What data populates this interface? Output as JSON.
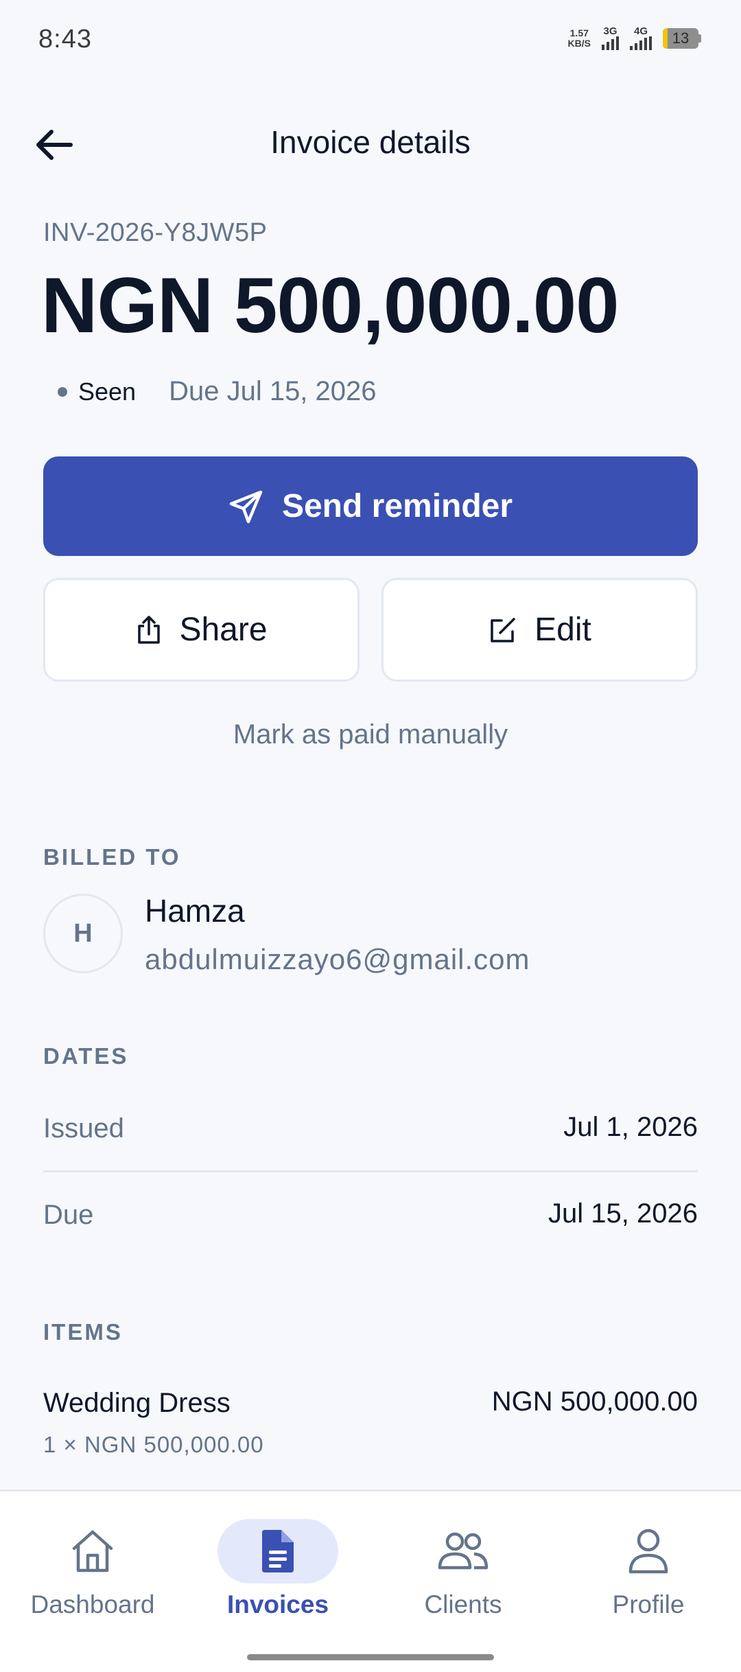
{
  "status_bar": {
    "time": "8:43",
    "net_speed_value": "1.57",
    "net_speed_unit": "KB/S",
    "signal_1": "3G",
    "signal_2": "4G",
    "battery": "13",
    "battery_level": 0.13
  },
  "header": {
    "title": "Invoice details",
    "back_icon": "arrow-left-icon"
  },
  "invoice": {
    "number": "INV-2026-Y8JW5P",
    "amount": "NGN 500,000.00",
    "status": "Seen",
    "due_text": "Due Jul 15, 2026"
  },
  "actions": {
    "send_reminder": "Send reminder",
    "share": "Share",
    "edit": "Edit",
    "mark_paid": "Mark as paid manually"
  },
  "billed_to": {
    "label": "BILLED TO",
    "initial": "H",
    "name": "Hamza",
    "email": "abdulmuizzayo6@gmail.com"
  },
  "dates": {
    "label": "DATES",
    "issued_label": "Issued",
    "issued_value": "Jul 1, 2026",
    "due_label": "Due",
    "due_value": "Jul 15, 2026"
  },
  "items": {
    "label": "ITEMS",
    "list": [
      {
        "name": "Wedding Dress",
        "detail": "1 × NGN 500,000.00",
        "total": "NGN 500,000.00"
      }
    ]
  },
  "nav": {
    "items": [
      {
        "label": "Dashboard",
        "icon": "home-icon"
      },
      {
        "label": "Invoices",
        "icon": "document-icon",
        "active": true
      },
      {
        "label": "Clients",
        "icon": "users-icon"
      },
      {
        "label": "Profile",
        "icon": "user-icon"
      }
    ]
  },
  "colors": {
    "accent": "#3a50b3",
    "background": "#f6f8fb",
    "muted": "#64748b"
  }
}
